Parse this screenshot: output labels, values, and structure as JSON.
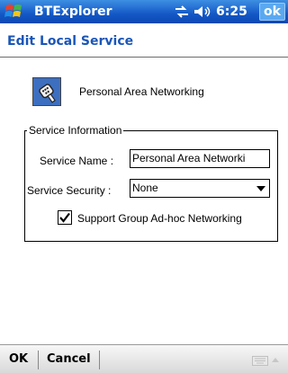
{
  "titlebar": {
    "app_title": "BTExplorer",
    "time": "6:25",
    "ok_label": "ok",
    "icons": [
      "start-flag-icon",
      "connectivity-icon",
      "volume-icon"
    ]
  },
  "dialog": {
    "header": "Edit Local Service",
    "service_name_display": "Personal Area Networking",
    "service_icon": "serial-plug-icon"
  },
  "service_info": {
    "legend": "Service Information",
    "name_label": "Service Name :",
    "name_value": "Personal Area Networki",
    "security_label": "Service Security :",
    "security_value": "None",
    "checkbox_label": "Support Group Ad-hoc Networking",
    "checkbox_checked": true
  },
  "menubar": {
    "ok": "OK",
    "cancel": "Cancel",
    "icons": [
      "keyboard-icon",
      "input-arrow-icon"
    ]
  },
  "colors": {
    "titlebar": "#1458c6",
    "header_text": "#1a56b8"
  }
}
